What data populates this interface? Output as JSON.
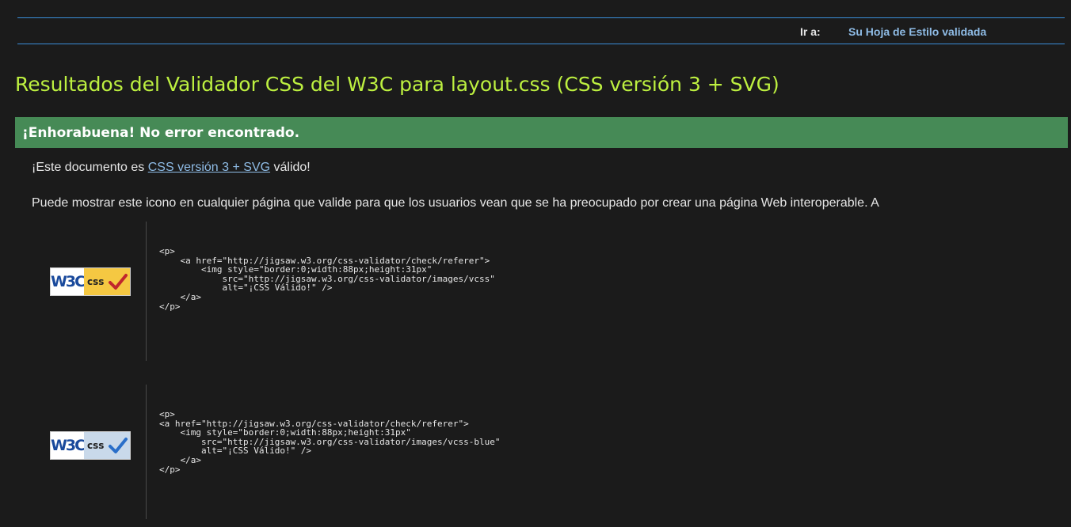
{
  "jump": {
    "label": "Ir a:",
    "link": "Su Hoja de Estilo validada"
  },
  "title": "Resultados del Validador CSS del W3C para layout.css (CSS versión 3 + SVG)",
  "congrats": "¡Enhorabuena! No error encontrado.",
  "valid": {
    "prefix": "¡Este documento es ",
    "link": "CSS versión 3 + SVG",
    "suffix": " válido!"
  },
  "icon_info": "Puede mostrar este icono en cualquier página que valide para que los usuarios vean que se ha preocupado por crear una página Web interoperable. A",
  "badges": [
    {
      "icon": "w3c-css-valid-gold-icon",
      "w3c_text": "W3C",
      "css_text": "css",
      "bg": "#f5c842",
      "check_color": "#c0262d",
      "code": "<p>\n    <a href=\"http://jigsaw.w3.org/css-validator/check/referer\">\n        <img style=\"border:0;width:88px;height:31px\"\n            src=\"http://jigsaw.w3.org/css-validator/images/vcss\"\n            alt=\"¡CSS Válido!\" />\n    </a>\n</p>"
    },
    {
      "icon": "w3c-css-valid-blue-icon",
      "w3c_text": "W3C",
      "css_text": "css",
      "bg": "#c9d9ea",
      "check_color": "#2a6fc9",
      "code": "<p>\n<a href=\"http://jigsaw.w3.org/css-validator/check/referer\">\n    <img style=\"border:0;width:88px;height:31px\"\n        src=\"http://jigsaw.w3.org/css-validator/images/vcss-blue\"\n        alt=\"¡CSS Válido!\" />\n    </a>\n</p>"
    }
  ],
  "colors": {
    "background": "#1b1b1b",
    "title": "#bdf040",
    "congrats_bar": "#468a56",
    "link": "#8fbce6",
    "jump_border": "#3a8ed9"
  }
}
